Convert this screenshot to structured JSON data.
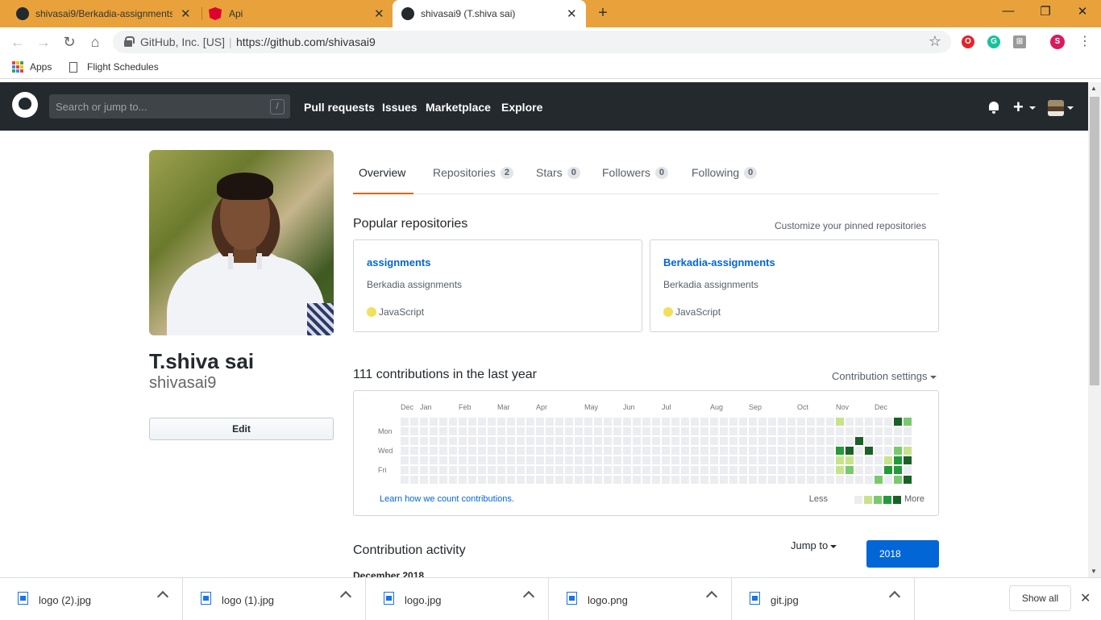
{
  "browser": {
    "tabs": [
      {
        "title": "shivasai9/Berkadia-assignments:"
      },
      {
        "title": "Api"
      },
      {
        "title": "shivasai9 (T.shiva sai)"
      }
    ],
    "new_tab": "+",
    "window_controls": {
      "minimize": "—",
      "restore": "❐",
      "close": "✕"
    },
    "address": {
      "org": "GitHub, Inc. [US]",
      "url": "https://github.com/shivasai9"
    },
    "extensions": [
      "opera-icon",
      "grammarly-icon",
      "cart-icon",
      "profile-icon"
    ],
    "profile_initial": "S",
    "bookmarks": [
      {
        "label": "Apps"
      },
      {
        "label": "Flight Schedules"
      }
    ]
  },
  "github": {
    "search_placeholder": "Search or jump to...",
    "search_key": "/",
    "nav": [
      "Pull requests",
      "Issues",
      "Marketplace",
      "Explore"
    ]
  },
  "profile": {
    "name": "T.shiva sai",
    "login": "shivasai9",
    "edit_label": "Edit"
  },
  "tabs": [
    {
      "label": "Overview"
    },
    {
      "label": "Repositories",
      "count": "2"
    },
    {
      "label": "Stars",
      "count": "0"
    },
    {
      "label": "Followers",
      "count": "0"
    },
    {
      "label": "Following",
      "count": "0"
    }
  ],
  "popular": {
    "heading": "Popular repositories",
    "customize": "Customize your pinned repositories",
    "repos": [
      {
        "name": "assignments",
        "description": "Berkadia assignments",
        "language": "JavaScript"
      },
      {
        "name": "Berkadia-assignments",
        "description": "Berkadia assignments",
        "language": "JavaScript"
      }
    ]
  },
  "contributions": {
    "heading": "111 contributions in the last year",
    "settings": "Contribution settings",
    "months": [
      "Dec",
      "Jan",
      "Feb",
      "Mar",
      "Apr",
      "May",
      "Jun",
      "Jul",
      "Aug",
      "Sep",
      "Oct",
      "Nov",
      "Dec"
    ],
    "days": [
      "Mon",
      "Wed",
      "Fri"
    ],
    "learn": "Learn how we count contributions.",
    "less": "Less",
    "more": "More",
    "colors": [
      "#ebedf0",
      "#c6e48b",
      "#7bc96f",
      "#239a3b",
      "#196127"
    ]
  },
  "activity": {
    "heading": "Contribution activity",
    "jump": "Jump to",
    "year": "2018",
    "month_header": "December 2018"
  },
  "downloads": {
    "files": [
      "logo (2).jpg",
      "logo (1).jpg",
      "logo.jpg",
      "logo.png",
      "git.jpg"
    ],
    "show_all": "Show all"
  }
}
